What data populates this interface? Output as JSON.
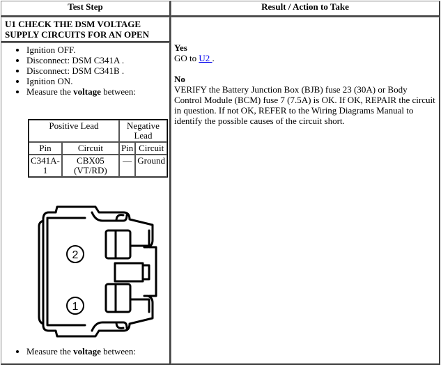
{
  "headers": {
    "test_step": "Test Step",
    "result": "Result / Action to Take"
  },
  "step": {
    "title": "U1 CHECK THE DSM VOLTAGE SUPPLY CIRCUITS FOR AN OPEN",
    "bullets": [
      "Ignition OFF.",
      "Disconnect: DSM C341A .",
      "Disconnect: DSM C341B .",
      "Ignition ON."
    ],
    "measure_prefix": "Measure the ",
    "measure_bold": "voltage",
    "measure_suffix": " between:"
  },
  "lead_table": {
    "positive": "Positive Lead",
    "negative": "Negative Lead",
    "pin": "Pin",
    "circuit": "Circuit",
    "row": {
      "pos_pin": "C341A-1",
      "pos_circuit": "CBX05 (VT/RD)",
      "neg_pin": "—",
      "neg_circuit": "Ground"
    }
  },
  "connector": {
    "pin_labels": [
      "2",
      "1"
    ]
  },
  "result": {
    "yes_label": "Yes",
    "yes_text_prefix": "GO to ",
    "yes_link": "U2 ",
    "yes_text_suffix": ".",
    "no_label": "No",
    "no_text": "VERIFY the Battery Junction Box (BJB) fuse 23 (30A) or Body Control Module (BCM) fuse 7 (7.5A) is OK. If OK, REPAIR the circuit in question. If not OK, REFER to the Wiring Diagrams Manual to identify the possible causes of the circuit short."
  }
}
